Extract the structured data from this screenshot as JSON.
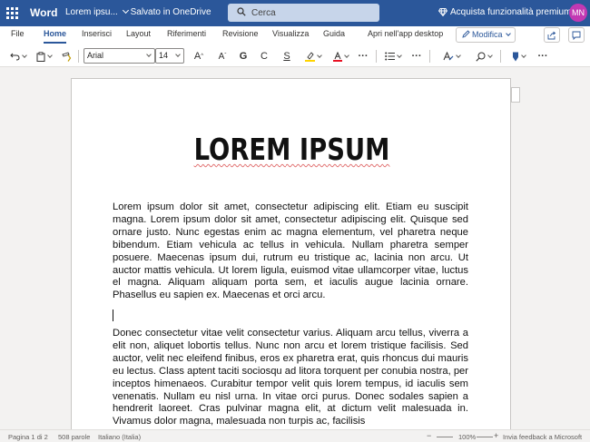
{
  "titlebar": {
    "app_name": "Word",
    "doc_title": "Lorem ipsu...",
    "save_status": "Salvato in OneDrive",
    "search_placeholder": "Cerca",
    "premium_label": "Acquista funzionalità premium",
    "avatar_initials": "MN",
    "brand_color": "#2b579a"
  },
  "menu": {
    "tabs": [
      "File",
      "Home",
      "Inserisci",
      "Layout",
      "Riferimenti",
      "Revisione",
      "Visualizza",
      "Guida",
      "Apri nell'app desktop"
    ],
    "active_tab": "Home",
    "mode_label": "Modifica"
  },
  "toolbar": {
    "font_name": "Arial",
    "font_size": "14",
    "grow_font": "A",
    "shrink_font": "A",
    "bold": "G",
    "italic": "C",
    "underline": "S",
    "more": "···",
    "icons": [
      "undo-icon",
      "clipboard-icon",
      "format-painter-icon",
      "highlighter-icon",
      "font-color-icon",
      "bullets-icon",
      "styles-icon",
      "find-icon",
      "sensitivity-icon"
    ]
  },
  "document": {
    "heading": "LOREM IPSUM",
    "paragraph1": "Lorem ipsum dolor sit amet, consectetur adipiscing elit. Etiam eu suscipit magna. Lorem ipsum dolor sit amet, consectetur adipiscing elit. Quisque sed ornare justo. Nunc egestas enim ac magna elementum, vel pharetra neque bibendum. Etiam vehicula ac tellus in vehicula. Nullam pharetra semper posuere. Maecenas ipsum dui, rutrum eu tristique ac, lacinia non arcu. Ut auctor mattis vehicula. Ut lorem ligula, euismod vitae ullamcorper vitae, luctus el magna. Aliquam aliquam porta sem, et iaculis augue lacinia ornare. Phasellus eu sapien ex. Maecenas et orci arcu.",
    "paragraph2": "Donec consectetur vitae velit consectetur varius. Aliquam arcu tellus, viverra a elit non, aliquet lobortis tellus. Nunc non arcu et lorem tristique facilisis. Sed auctor, velit nec eleifend finibus, eros ex pharetra erat, quis rhoncus dui mauris eu lectus. Class aptent taciti sociosqu ad litora torquent per conubia nostra, per inceptos himenaeos. Curabitur tempor velit quis lorem tempus, id iaculis sem venenatis. Nullam eu nisl urna. In vitae orci purus. Donec sodales sapien a hendrerit laoreet. Cras pulvinar magna elit, at dictum velit malesuada in. Vivamus dolor magna, malesuada non turpis ac, facilisis"
  },
  "statusbar": {
    "page_info": "Pagina 1 di 2",
    "word_count": "508 parole",
    "language": "Italiano (Italia)",
    "zoom_minus": "−",
    "zoom_level": "100%",
    "zoom_plus": "+",
    "feedback": "Invia feedback a Microsoft"
  }
}
